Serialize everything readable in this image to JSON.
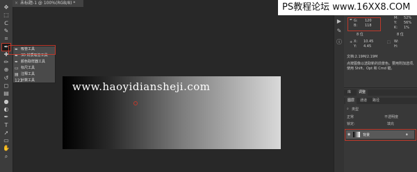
{
  "document": {
    "tab_title": "未标题-1 @ 100%(RGB/8) *"
  },
  "toolbar": {
    "icons": [
      "move-icon",
      "marquee-icon",
      "lasso-icon",
      "quick-select-icon",
      "crop-icon",
      "eyedropper-icon",
      "healing-brush-icon",
      "brush-icon",
      "clone-stamp-icon",
      "history-brush-icon",
      "eraser-icon",
      "gradient-icon",
      "blur-icon",
      "dodge-icon",
      "pen-icon",
      "type-icon",
      "path-select-icon",
      "shape-icon",
      "hand-icon",
      "zoom-icon"
    ],
    "glyphs": [
      "✥",
      "⬚",
      "ᑕ",
      "✎",
      "⌗",
      "✒",
      "✚",
      "✏",
      "⊕",
      "↺",
      "◻",
      "▤",
      "●",
      "◐",
      "✒",
      "T",
      "➚",
      "▭",
      "✋",
      "⌕"
    ],
    "active_index": 5
  },
  "flyout": {
    "items": [
      {
        "icon": "✒",
        "label": "吸管工具"
      },
      {
        "icon": "✒",
        "label": "3D 材质吸管工具"
      },
      {
        "icon": "✒",
        "label": "颜色取样器工具"
      },
      {
        "icon": "▭",
        "label": "标尺工具"
      },
      {
        "icon": "▤",
        "label": "注释工具"
      },
      {
        "icon": "123",
        "label": "计数工具"
      }
    ],
    "highlighted_index": 0
  },
  "watermarks": {
    "top": "PS教程论坛 www.16XX8.COM",
    "url": "www.haoyidiansheji.com"
  },
  "info": {
    "g_label": "G:",
    "g_value": "120",
    "b_label": "B:",
    "b_value": "118",
    "bit_left": "8 位",
    "right_col": [
      "M:",
      "Y:",
      "K:"
    ],
    "right_vals": [
      "52%",
      "56%",
      "1%"
    ],
    "bit_right": "8 位",
    "x_label": "X:",
    "x_value": "10.45",
    "y_label": "Y:",
    "y_value": "4.45",
    "w_label": "W:",
    "h_label": "H:",
    "doc_size": "文档:2.19M/2.19M",
    "hint_line1": "点按图像以选取新的前景色。要用附加选项,",
    "hint_line2": "使用 Shift、Opt 和 Cmd 键。"
  },
  "layers_panel": {
    "top_tabs": [
      "库",
      "调整"
    ],
    "sub_tabs": [
      "图层",
      "通道",
      "路径"
    ],
    "kind_label": "类型",
    "blend_mode": "正常",
    "opacity_label": "不透明度",
    "lock_label": "锁定:",
    "fill_label": "填充",
    "layer_name": "背景"
  },
  "colors": {
    "accent_red": "#c0392b",
    "panel_bg": "#383838",
    "canvas_bg": "#282828"
  }
}
